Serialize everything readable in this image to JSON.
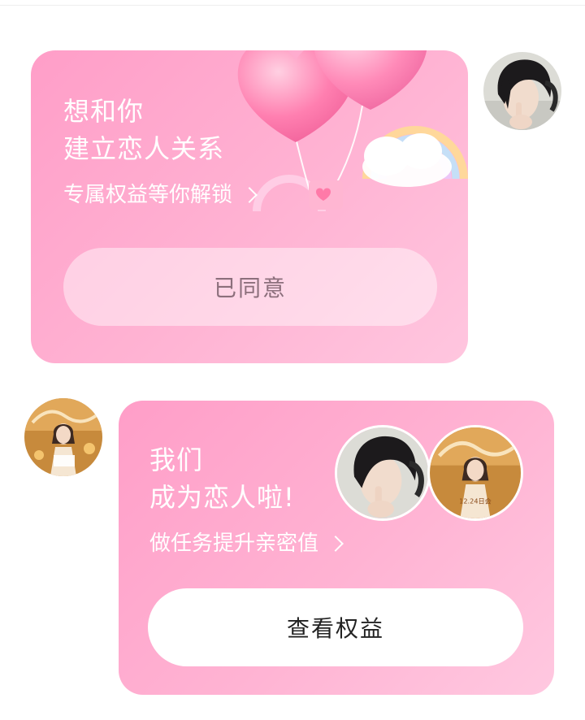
{
  "invite_card": {
    "title_line1": "想和你",
    "title_line2": "建立恋人关系",
    "subtitle": "专属权益等你解锁",
    "button_label": "已同意"
  },
  "lovers_card": {
    "title_line1": "我们",
    "title_line2": "成为恋人啦!",
    "subtitle": "做任务提升亲密值",
    "button_label": "查看权益"
  },
  "avatars": {
    "self": "dark-hair-male-avatar",
    "partner": "birthday-female-avatar",
    "partner_photo_text": "12.24日会"
  },
  "colors": {
    "card_gradient_start": "#ff9ec8",
    "card_gradient_end": "#ffc6df",
    "agreed_button_text": "#8c6f7c",
    "primary_button_bg": "#ffffff"
  }
}
